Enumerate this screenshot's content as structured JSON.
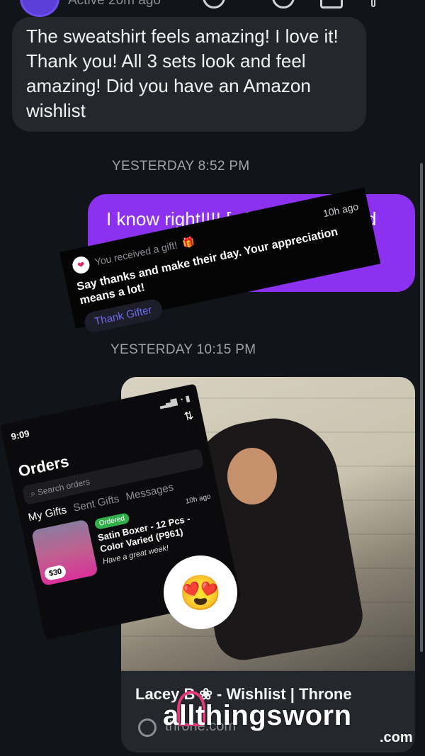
{
  "header": {
    "active_status": "Active 20m ago"
  },
  "messages": {
    "incoming_1": "The sweatshirt feels amazing!  I love it!  Thank you!  All 3 sets look and feel amazing!  Did you have an Amazon wishlist",
    "timestamp_1": "YESTERDAY 8:52 PM",
    "outgoing_1": "I know right!!!! [...] e is soft [...] nd",
    "timestamp_2": "YESTERDAY 10:15 PM"
  },
  "gift_notification": {
    "header": "You received a gift!",
    "gift_icon": "gift-icon",
    "time": "10h ago",
    "message": "Say thanks and make their day. Your appreciation means a lot!",
    "button": "Thank Gifter"
  },
  "orders_screenshot": {
    "status_time": "9:09",
    "title": "Orders",
    "search_placeholder": "Search orders",
    "tabs": [
      "My Gifts",
      "Sent Gifts",
      "Messages"
    ],
    "item": {
      "badge": "Ordered",
      "time": "10h ago",
      "name": "Satin Boxer - 12 Pcs - Color Varied (P961)",
      "note": "Have a great week!",
      "price": "$30"
    }
  },
  "link_card": {
    "title": "Lacey B ❀ - Wishlist | Throne",
    "domain": "throne.com"
  },
  "reaction_emoji": "😍",
  "watermark": {
    "text": "allthingsworn",
    "suffix": ".com"
  },
  "colors": {
    "outgoing": "#8c31f0",
    "incoming": "#24272c",
    "background": "#111418"
  }
}
